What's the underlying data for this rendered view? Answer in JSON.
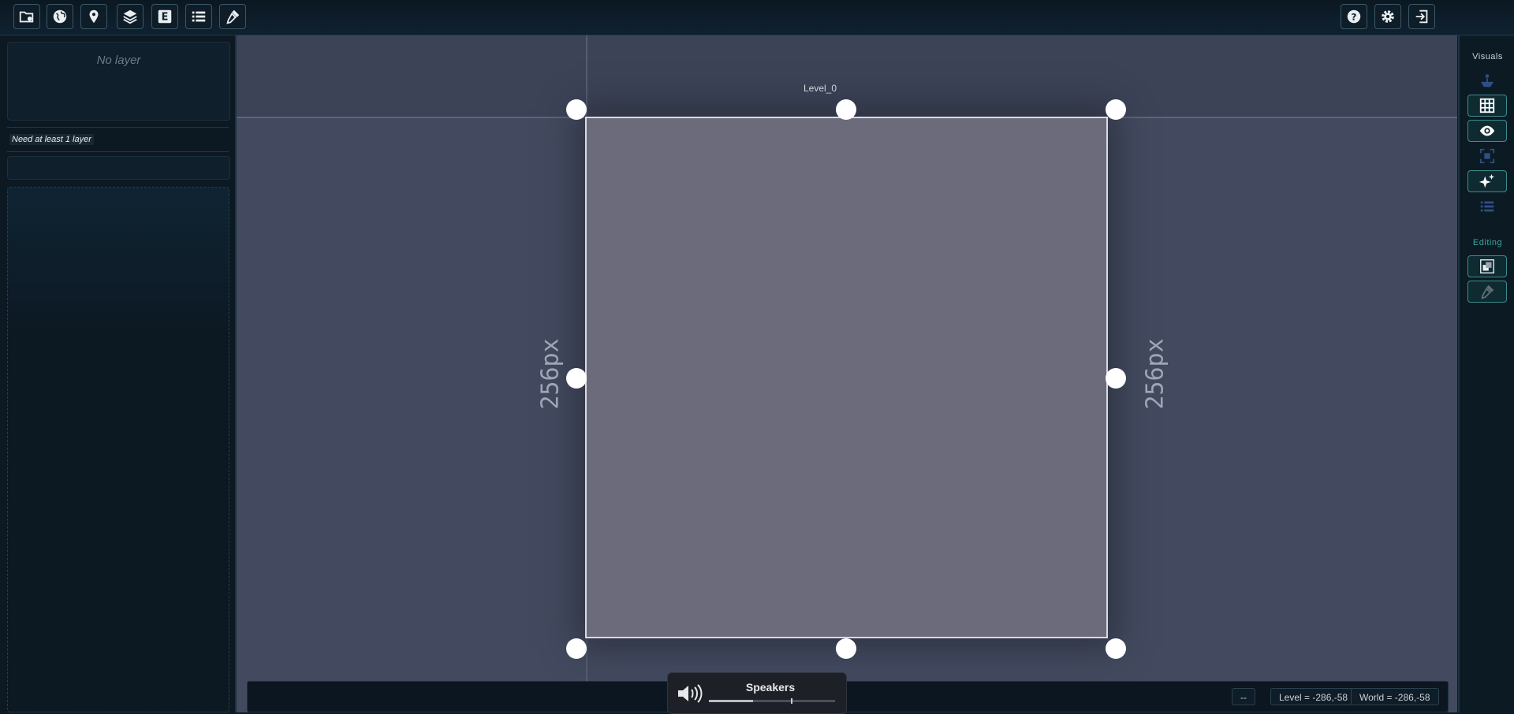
{
  "toolbar": {
    "left_buttons": [
      {
        "icon": "project-settings-icon"
      },
      {
        "icon": "world-icon"
      },
      {
        "icon": "location-pin-icon"
      },
      {
        "icon": "layers-icon"
      },
      {
        "icon": "entity-icon",
        "glyph": "E"
      },
      {
        "icon": "list-icon"
      },
      {
        "icon": "edit-tool-icon"
      }
    ],
    "right_buttons": [
      {
        "icon": "help-icon"
      },
      {
        "icon": "settings-gear-icon"
      },
      {
        "icon": "exit-icon"
      }
    ]
  },
  "left_panel": {
    "empty_text": "No layer",
    "warning": "Need at least 1 layer"
  },
  "canvas": {
    "level_name": "Level_0",
    "width_label": "256px",
    "height_label": "256px",
    "level_fill_color": "#6b6b7c",
    "background_color": "#434a5f"
  },
  "status": {
    "dash": "--",
    "level_coords": "Level = -286,-58",
    "world_coords": "World = -286,-58"
  },
  "speakers": {
    "label": "Speakers",
    "volume": 0.35
  },
  "right_panel": {
    "visuals_title": "Visuals",
    "editing_title": "Editing",
    "accent_color": "#3f8c8c",
    "visuals_buttons": [
      {
        "icon": "layers-stack-icon",
        "active": false
      },
      {
        "icon": "grid-icon",
        "active": true
      },
      {
        "icon": "eye-icon",
        "active": true
      },
      {
        "icon": "focus-icon",
        "active": false
      },
      {
        "icon": "sparkle-icon",
        "active": true
      },
      {
        "icon": "details-list-icon",
        "active": false
      }
    ],
    "editing_buttons": [
      {
        "icon": "tile-stack-icon",
        "active": true
      },
      {
        "icon": "picker-icon",
        "active": true
      }
    ]
  }
}
